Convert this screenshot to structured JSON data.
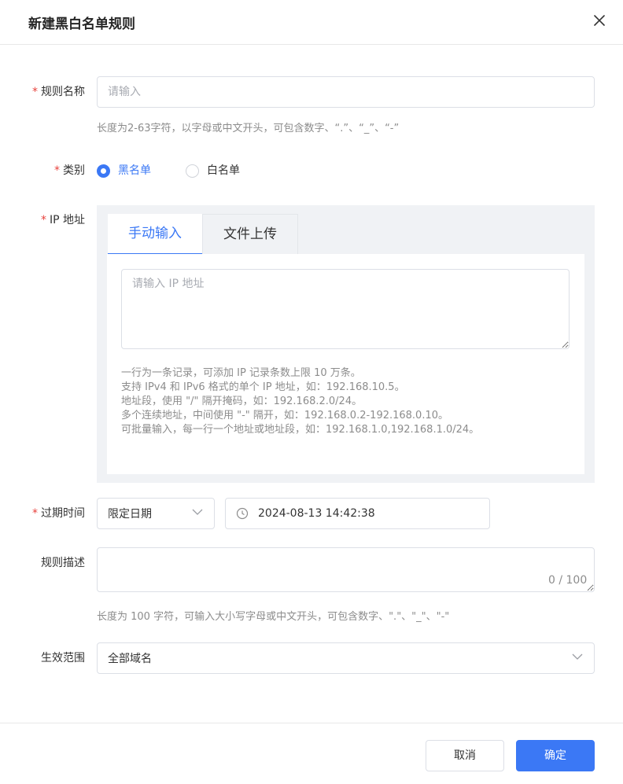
{
  "dialog": {
    "title": "新建黑白名单规则"
  },
  "form": {
    "required_mark": "*",
    "rule_name": {
      "label": "规则名称",
      "placeholder": "请输入",
      "value": "",
      "hint": "长度为2-63字符，以字母或中文开头，可包含数字、“.”、“_”、“-”"
    },
    "category": {
      "label": "类别",
      "options": [
        {
          "label": "黑名单",
          "checked": true
        },
        {
          "label": "白名单",
          "checked": false
        }
      ]
    },
    "ip": {
      "label": "IP 地址",
      "tabs": [
        {
          "label": "手动输入",
          "active": true
        },
        {
          "label": "文件上传",
          "active": false
        }
      ],
      "placeholder": "请输入 IP 地址",
      "hints": [
        "一行为一条记录，可添加 IP 记录条数上限 10 万条。",
        "支持 IPv4 和 IPv6 格式的单个 IP 地址，如：192.168.10.5。",
        "地址段，使用 \"/\" 隔开掩码，如：192.168.2.0/24。",
        "多个连续地址，中间使用 \"-\" 隔开，如：192.168.0.2-192.168.0.10。",
        "可批量输入，每一行一个地址或地址段，如：192.168.1.0,192.168.1.0/24。"
      ]
    },
    "expire": {
      "label": "过期时间",
      "mode_value": "限定日期",
      "datetime_value": "2024-08-13 14:42:38"
    },
    "description": {
      "label": "规则描述",
      "value": "",
      "counter": "0 / 100",
      "hint": "长度为 100 字符，可输入大小写字母或中文开头，可包含数字、\".\"、\"_\"、\"-\""
    },
    "scope": {
      "label": "生效范围",
      "value": "全部域名"
    }
  },
  "footer": {
    "cancel_label": "取消",
    "ok_label": "确定"
  },
  "colors": {
    "accent": "#3b78f5",
    "required": "#e8423d",
    "border": "#dcdfe6",
    "panel_bg": "#f0f2f5"
  }
}
